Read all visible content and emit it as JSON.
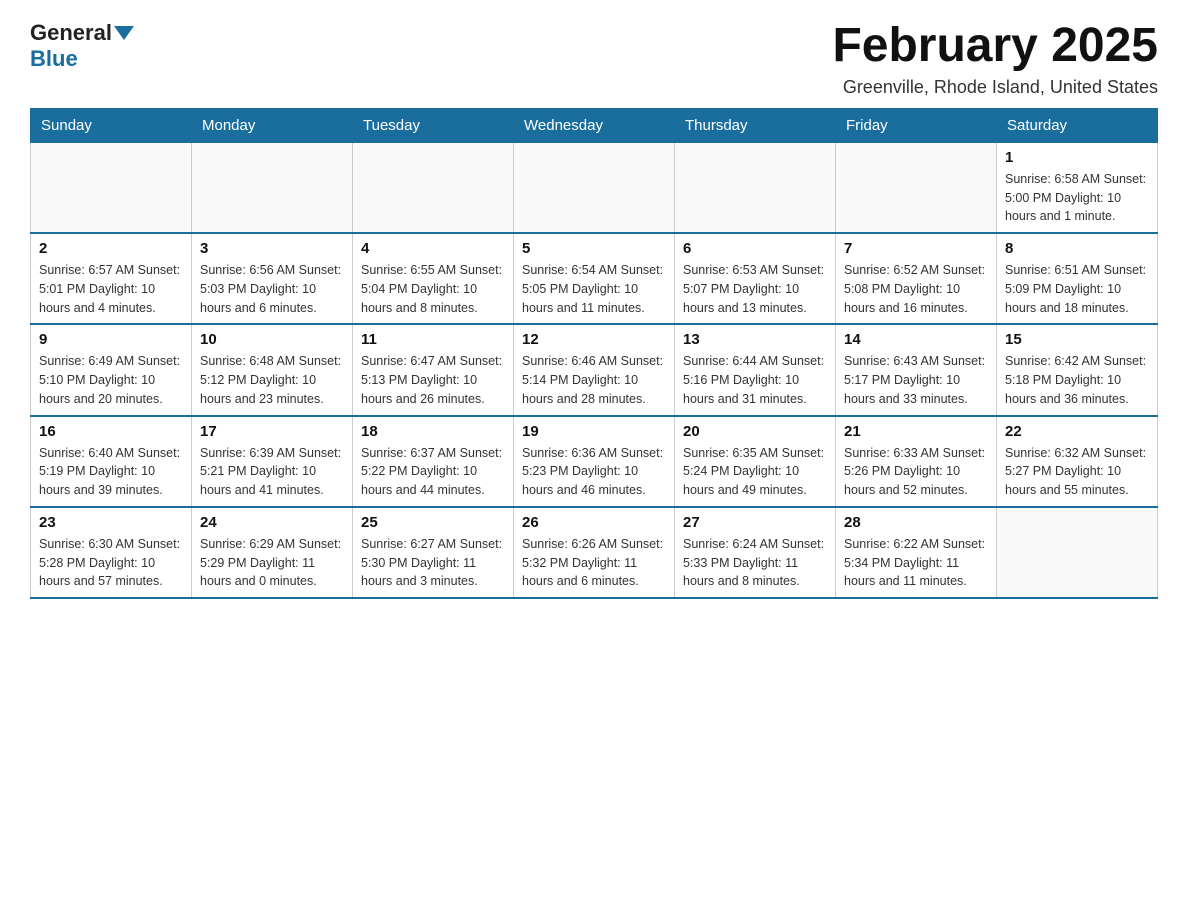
{
  "logo": {
    "general": "General",
    "blue": "Blue"
  },
  "header": {
    "month_title": "February 2025",
    "location": "Greenville, Rhode Island, United States"
  },
  "weekdays": [
    "Sunday",
    "Monday",
    "Tuesday",
    "Wednesday",
    "Thursday",
    "Friday",
    "Saturday"
  ],
  "weeks": [
    [
      {
        "day": "",
        "info": ""
      },
      {
        "day": "",
        "info": ""
      },
      {
        "day": "",
        "info": ""
      },
      {
        "day": "",
        "info": ""
      },
      {
        "day": "",
        "info": ""
      },
      {
        "day": "",
        "info": ""
      },
      {
        "day": "1",
        "info": "Sunrise: 6:58 AM\nSunset: 5:00 PM\nDaylight: 10 hours and 1 minute."
      }
    ],
    [
      {
        "day": "2",
        "info": "Sunrise: 6:57 AM\nSunset: 5:01 PM\nDaylight: 10 hours and 4 minutes."
      },
      {
        "day": "3",
        "info": "Sunrise: 6:56 AM\nSunset: 5:03 PM\nDaylight: 10 hours and 6 minutes."
      },
      {
        "day": "4",
        "info": "Sunrise: 6:55 AM\nSunset: 5:04 PM\nDaylight: 10 hours and 8 minutes."
      },
      {
        "day": "5",
        "info": "Sunrise: 6:54 AM\nSunset: 5:05 PM\nDaylight: 10 hours and 11 minutes."
      },
      {
        "day": "6",
        "info": "Sunrise: 6:53 AM\nSunset: 5:07 PM\nDaylight: 10 hours and 13 minutes."
      },
      {
        "day": "7",
        "info": "Sunrise: 6:52 AM\nSunset: 5:08 PM\nDaylight: 10 hours and 16 minutes."
      },
      {
        "day": "8",
        "info": "Sunrise: 6:51 AM\nSunset: 5:09 PM\nDaylight: 10 hours and 18 minutes."
      }
    ],
    [
      {
        "day": "9",
        "info": "Sunrise: 6:49 AM\nSunset: 5:10 PM\nDaylight: 10 hours and 20 minutes."
      },
      {
        "day": "10",
        "info": "Sunrise: 6:48 AM\nSunset: 5:12 PM\nDaylight: 10 hours and 23 minutes."
      },
      {
        "day": "11",
        "info": "Sunrise: 6:47 AM\nSunset: 5:13 PM\nDaylight: 10 hours and 26 minutes."
      },
      {
        "day": "12",
        "info": "Sunrise: 6:46 AM\nSunset: 5:14 PM\nDaylight: 10 hours and 28 minutes."
      },
      {
        "day": "13",
        "info": "Sunrise: 6:44 AM\nSunset: 5:16 PM\nDaylight: 10 hours and 31 minutes."
      },
      {
        "day": "14",
        "info": "Sunrise: 6:43 AM\nSunset: 5:17 PM\nDaylight: 10 hours and 33 minutes."
      },
      {
        "day": "15",
        "info": "Sunrise: 6:42 AM\nSunset: 5:18 PM\nDaylight: 10 hours and 36 minutes."
      }
    ],
    [
      {
        "day": "16",
        "info": "Sunrise: 6:40 AM\nSunset: 5:19 PM\nDaylight: 10 hours and 39 minutes."
      },
      {
        "day": "17",
        "info": "Sunrise: 6:39 AM\nSunset: 5:21 PM\nDaylight: 10 hours and 41 minutes."
      },
      {
        "day": "18",
        "info": "Sunrise: 6:37 AM\nSunset: 5:22 PM\nDaylight: 10 hours and 44 minutes."
      },
      {
        "day": "19",
        "info": "Sunrise: 6:36 AM\nSunset: 5:23 PM\nDaylight: 10 hours and 46 minutes."
      },
      {
        "day": "20",
        "info": "Sunrise: 6:35 AM\nSunset: 5:24 PM\nDaylight: 10 hours and 49 minutes."
      },
      {
        "day": "21",
        "info": "Sunrise: 6:33 AM\nSunset: 5:26 PM\nDaylight: 10 hours and 52 minutes."
      },
      {
        "day": "22",
        "info": "Sunrise: 6:32 AM\nSunset: 5:27 PM\nDaylight: 10 hours and 55 minutes."
      }
    ],
    [
      {
        "day": "23",
        "info": "Sunrise: 6:30 AM\nSunset: 5:28 PM\nDaylight: 10 hours and 57 minutes."
      },
      {
        "day": "24",
        "info": "Sunrise: 6:29 AM\nSunset: 5:29 PM\nDaylight: 11 hours and 0 minutes."
      },
      {
        "day": "25",
        "info": "Sunrise: 6:27 AM\nSunset: 5:30 PM\nDaylight: 11 hours and 3 minutes."
      },
      {
        "day": "26",
        "info": "Sunrise: 6:26 AM\nSunset: 5:32 PM\nDaylight: 11 hours and 6 minutes."
      },
      {
        "day": "27",
        "info": "Sunrise: 6:24 AM\nSunset: 5:33 PM\nDaylight: 11 hours and 8 minutes."
      },
      {
        "day": "28",
        "info": "Sunrise: 6:22 AM\nSunset: 5:34 PM\nDaylight: 11 hours and 11 minutes."
      },
      {
        "day": "",
        "info": ""
      }
    ]
  ]
}
